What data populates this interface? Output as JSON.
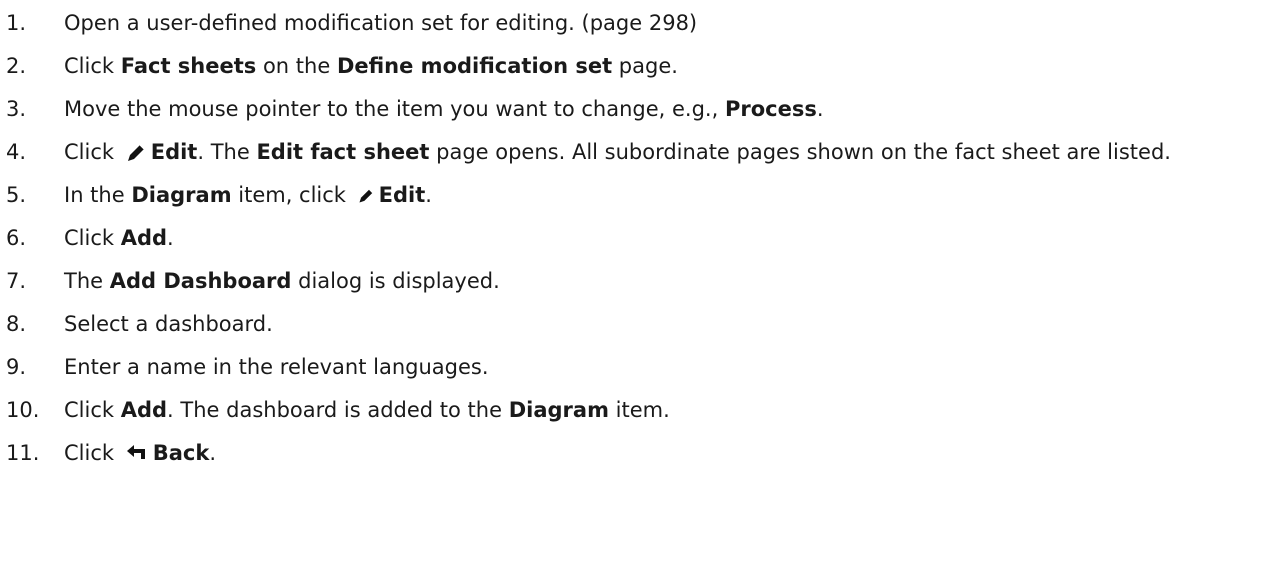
{
  "steps": [
    {
      "num": "1.",
      "t0": "Open a user-defined modification set for editing. (page 298)"
    },
    {
      "num": "2.",
      "t0": "Click ",
      "b1": "Fact sheets",
      "t2": " on the ",
      "b3": "Define modification set",
      "t4": " page."
    },
    {
      "num": "3.",
      "t0": "Move the mouse pointer to the item you want to change, e.g., ",
      "b1": "Process",
      "t2": "."
    },
    {
      "num": "4.",
      "t0": "Click ",
      "icon": "pencil-icon",
      "b1": "Edit",
      "t2": ". The ",
      "b3": "Edit fact sheet",
      "t4": " page opens. All subordinate pages shown on the fact sheet are listed."
    },
    {
      "num": "5.",
      "t0": "In the ",
      "b1": "Diagram",
      "t2": " item, click ",
      "icon": "pencil-icon",
      "b3": "Edit",
      "t4": "."
    },
    {
      "num": "6.",
      "t0": "Click ",
      "b1": "Add",
      "t2": "."
    },
    {
      "num": "7.",
      "t0": "The ",
      "b1": "Add Dashboard",
      "t2": " dialog is displayed."
    },
    {
      "num": "8.",
      "t0": "Select a dashboard."
    },
    {
      "num": "9.",
      "t0": "Enter a name in the relevant languages."
    },
    {
      "num": "10.",
      "t0": "Click ",
      "b1": "Add",
      "t2": ". The dashboard is added to the ",
      "b3": "Diagram",
      "t4": " item."
    },
    {
      "num": "11.",
      "t0": "Click ",
      "icon": "back-arrow-icon",
      "b1": "Back",
      "t2": "."
    }
  ]
}
